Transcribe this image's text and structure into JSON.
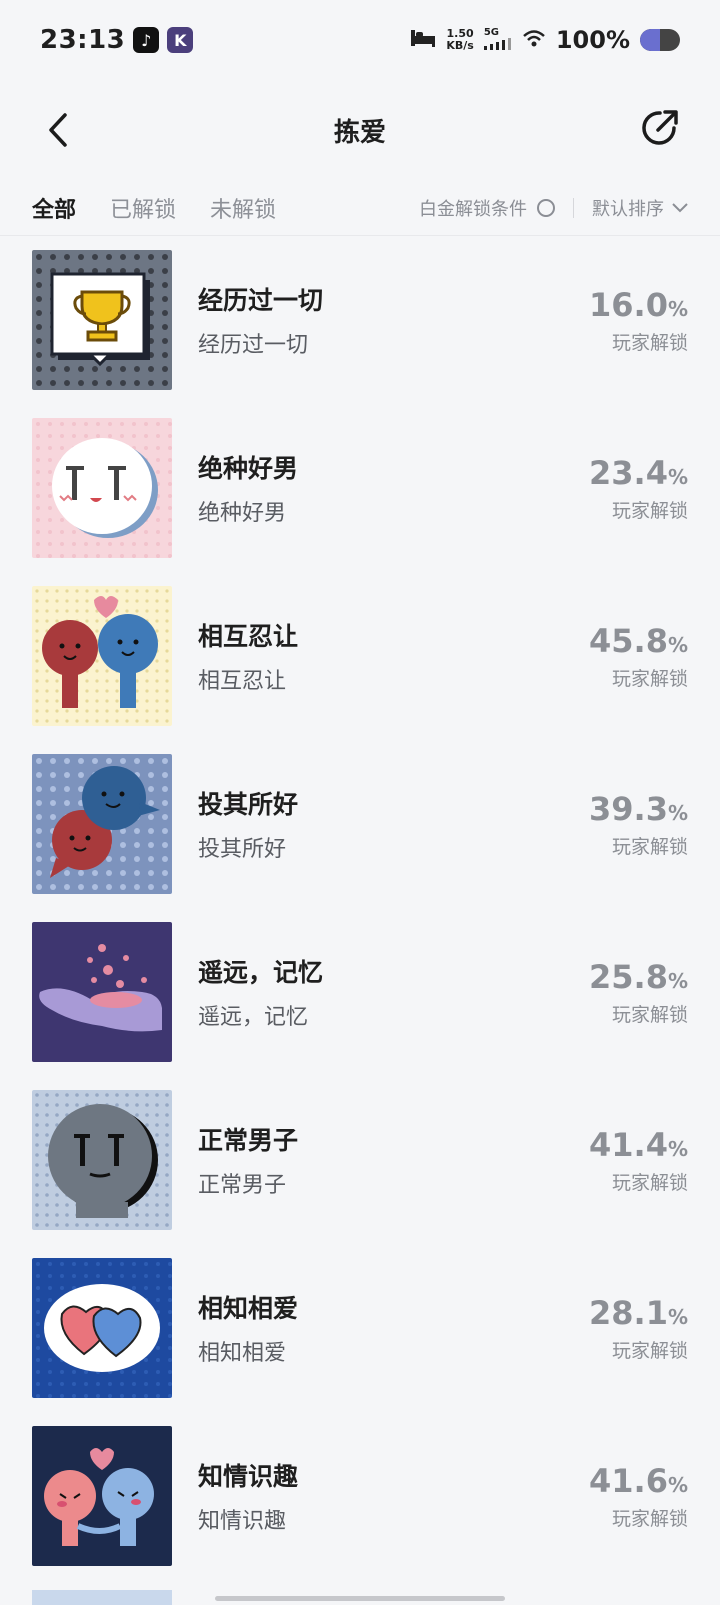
{
  "status": {
    "time": "23:13",
    "speed_top": "1.50",
    "speed_unit": "KB/s",
    "network": "5G",
    "battery": "100%"
  },
  "header": {
    "title": "拣爱"
  },
  "tabs": [
    {
      "label": "全部",
      "active": true
    },
    {
      "label": "已解锁",
      "active": false
    },
    {
      "label": "未解锁",
      "active": false
    }
  ],
  "filter": {
    "platinum_label": "白金解锁条件",
    "sort_label": "默认排序"
  },
  "achievements": [
    {
      "name": "经历过一切",
      "desc": "经历过一切",
      "percent": "16.0",
      "label": "玩家解锁",
      "icon": "trophy-icon"
    },
    {
      "name": "绝种好男",
      "desc": "绝种好男",
      "percent": "23.4",
      "label": "玩家解锁",
      "icon": "shy-face-icon"
    },
    {
      "name": "相互忍让",
      "desc": "相互忍让",
      "percent": "45.8",
      "label": "玩家解锁",
      "icon": "couple-icon"
    },
    {
      "name": "投其所好",
      "desc": "投其所好",
      "percent": "39.3",
      "label": "玩家解锁",
      "icon": "chat-bubbles-icon"
    },
    {
      "name": "遥远，记忆",
      "desc": "遥远，记忆",
      "percent": "25.8",
      "label": "玩家解锁",
      "icon": "hand-icon"
    },
    {
      "name": "正常男子",
      "desc": "正常男子",
      "percent": "41.4",
      "label": "玩家解锁",
      "icon": "gray-face-icon"
    },
    {
      "name": "相知相爱",
      "desc": "相知相爱",
      "percent": "28.1",
      "label": "玩家解锁",
      "icon": "hearts-icon"
    },
    {
      "name": "知情识趣",
      "desc": "知情识趣",
      "percent": "41.6",
      "label": "玩家解锁",
      "icon": "holding-hands-icon"
    }
  ]
}
